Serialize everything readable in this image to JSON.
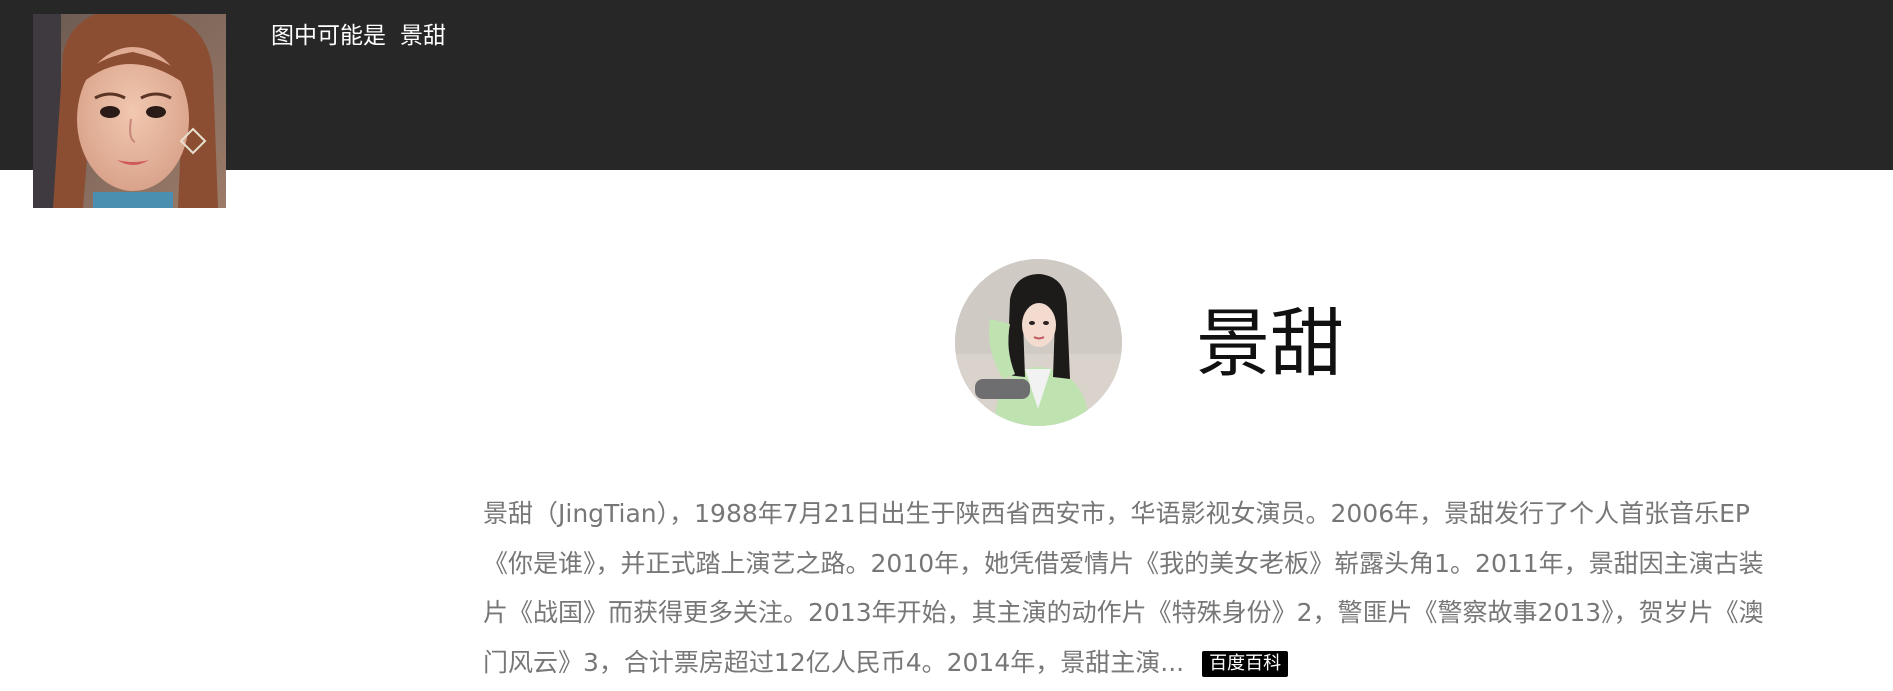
{
  "header": {
    "caption_prefix": "图中可能是",
    "caption_name": "景甜",
    "background_color": "#272727"
  },
  "entity": {
    "name": "景甜",
    "bio": "景甜（JingTian），1988年7月21日出生于陕西省西安市，华语影视女演员。2006年，景甜发行了个人首张音乐EP《你是谁》，并正式踏上演艺之路。2010年，她凭借爱情片《我的美女老板》崭露头角1。2011年，景甜因主演古装片《战国》而获得更多关注。2013年开始，其主演的动作片《特殊身份》2，警匪片《警察故事2013》，贺岁片《澳门风云》3，合计票房超过12亿人民币4。2014年，景甜主演...",
    "source_badge": "百度百科"
  },
  "colors": {
    "bio_text": "#777777",
    "badge_bg": "#000000",
    "badge_text": "#ffffff"
  }
}
